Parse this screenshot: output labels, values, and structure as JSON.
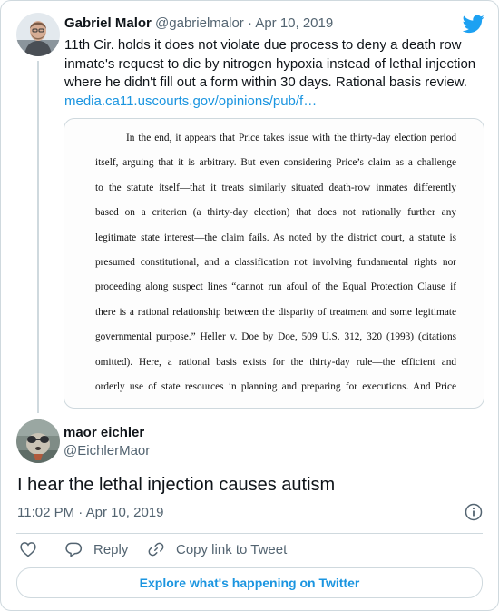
{
  "quoted_tweet": {
    "name": "Gabriel Malor",
    "handle": "@gabrielmalor",
    "separator": "·",
    "date": "Apr 10, 2019",
    "text": "11th Cir. holds it does not violate due process to deny a death row inmate's request to die by nitrogen hypoxia instead of lethal injection where he didn't fill out a form within 30 days. Rational basis review.",
    "link": "media.ca11.uscourts.gov/opinions/pub/f…",
    "document_lines": [
      "In the end, it appears that Price takes issue with the thirty-day election period",
      "itself, arguing that it is arbitrary.  But even considering Price’s claim as a challenge",
      "to the statute itself—that it treats similarly situated death-row inmates differently",
      "based on a criterion (a thirty-day election) that does not rationally further any",
      "legitimate state interest—the claim fails.  As noted by the district court, a statute is",
      "presumed constitutional, and a classification not involving fundamental rights nor",
      "proceeding along suspect lines “cannot run afoul of the Equal Protection Clause if",
      "there is a rational relationship between the disparity of treatment and some legitimate",
      "governmental purpose.”  Heller v. Doe by Doe, 509 U.S. 312, 320 (1993) (citations",
      "omitted).  Here, a rational basis exists for the thirty-day rule—the efficient and",
      "orderly use of state resources in planning and preparing for executions.  And Price"
    ]
  },
  "tweet": {
    "name": "maor eichler",
    "handle": "@EichlerMaor",
    "text": "I hear the lethal injection causes autism",
    "timestamp": "11:02 PM · Apr 10, 2019"
  },
  "actions": {
    "reply_label": "Reply",
    "copy_link_label": "Copy link to Tweet"
  },
  "explore_label": "Explore what's happening on Twitter",
  "icons": {
    "logo": "twitter-bird-icon",
    "info": "info-icon",
    "like": "heart-icon",
    "reply": "reply-bubble-icon",
    "copy": "link-icon"
  },
  "colors": {
    "twitter_blue": "#1da1f2",
    "link_blue": "#1b95e0",
    "text_dark": "#0f1419",
    "text_gray": "#536471",
    "border": "#cfd9de"
  }
}
